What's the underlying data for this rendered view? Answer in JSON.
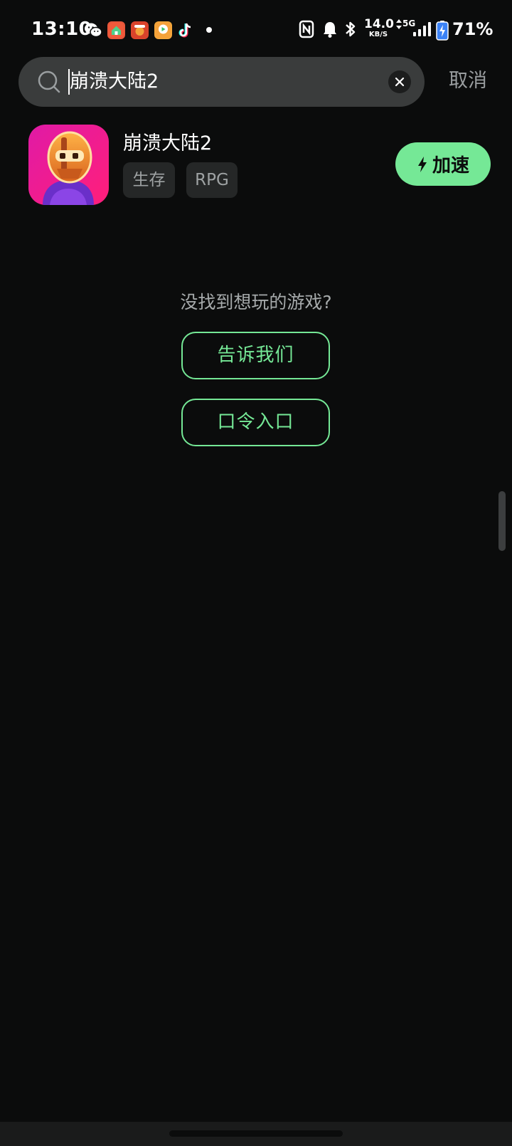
{
  "status_bar": {
    "time": "13:10",
    "net_speed_value": "14.0",
    "net_speed_unit": "KB/S",
    "network_type": "5G",
    "battery_percent": "71%",
    "notification_icons": [
      "wechat-icon",
      "home-app-icon",
      "red-app-icon",
      "video-app-icon",
      "tiktok-icon"
    ]
  },
  "search": {
    "query": "崩溃大陆2",
    "cancel_label": "取消"
  },
  "result": {
    "title": "崩溃大陆2",
    "tags": [
      "生存",
      "RPG"
    ],
    "boost_label": "加速",
    "accent_color": "#75e896"
  },
  "not_found": {
    "prompt": "没找到想玩的游戏?",
    "tell_us_label": "告诉我们",
    "code_entry_label": "口令入口"
  }
}
